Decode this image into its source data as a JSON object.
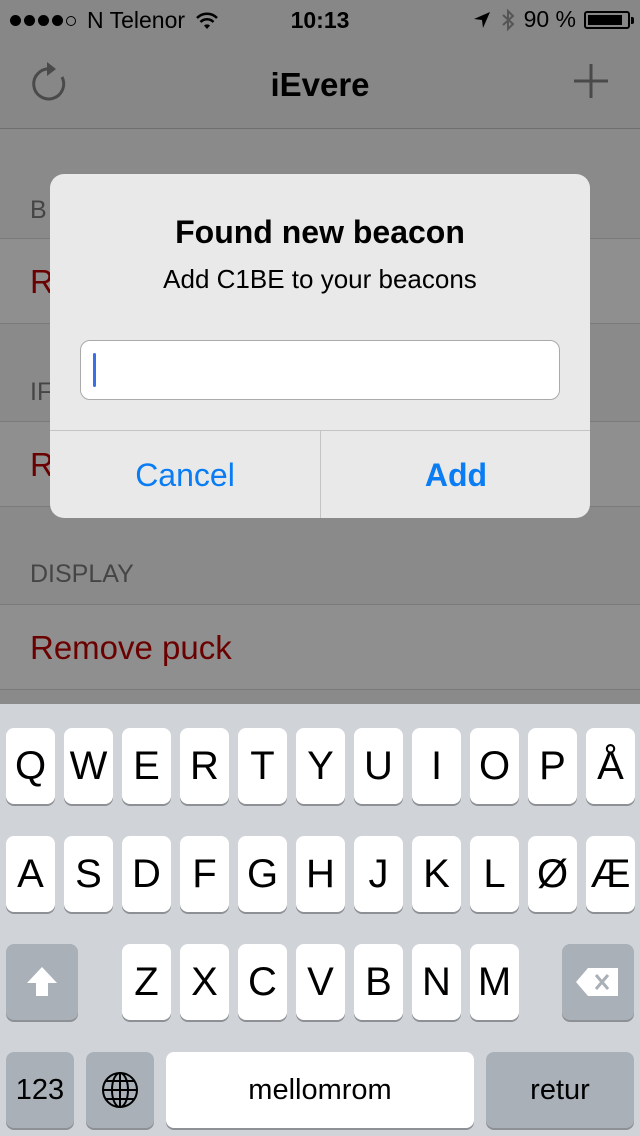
{
  "status_bar": {
    "carrier": "N Telenor",
    "time": "10:13",
    "battery_percent": "90 %",
    "battery_level": 0.9
  },
  "nav": {
    "title": "iEvere",
    "refresh_icon": "refresh-icon",
    "add_icon": "plus-icon"
  },
  "table": {
    "section_partial_1": "B",
    "row_partial_1": "R",
    "section_partial_2": "IF",
    "row_partial_2": "R",
    "section_display": "DISPLAY",
    "row_remove_puck": "Remove puck"
  },
  "alert": {
    "title": "Found new beacon",
    "message": "Add C1BE to your beacons",
    "field_value": "",
    "cancel": "Cancel",
    "add": "Add"
  },
  "keyboard": {
    "row1": [
      "Q",
      "W",
      "E",
      "R",
      "T",
      "Y",
      "U",
      "I",
      "O",
      "P",
      "Å"
    ],
    "row2": [
      "A",
      "S",
      "D",
      "F",
      "G",
      "H",
      "J",
      "K",
      "L",
      "Ø",
      "Æ"
    ],
    "row3": [
      "Z",
      "X",
      "C",
      "V",
      "B",
      "N",
      "M"
    ],
    "numbers": "123",
    "space": "mellomrom",
    "return": "retur"
  },
  "colors": {
    "accent": "#0a7cf4",
    "destructive": "#6b0000"
  }
}
